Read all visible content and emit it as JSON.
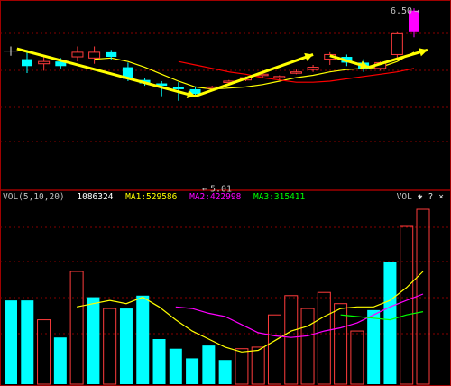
{
  "chart_data": [
    {
      "type": "candlestick",
      "annotations": {
        "high_label": "6.50",
        "low_label": "5.01"
      },
      "ylim": [
        4.95,
        6.54
      ],
      "candles": [
        {
          "o": 6.06,
          "h": 6.14,
          "l": 5.94,
          "c": 6.0,
          "dir": "down"
        },
        {
          "o": 6.02,
          "h": 6.08,
          "l": 5.96,
          "c": 6.04,
          "dir": "up"
        },
        {
          "o": 6.04,
          "h": 6.07,
          "l": 5.98,
          "c": 6.0,
          "dir": "down"
        },
        {
          "o": 6.08,
          "h": 6.17,
          "l": 6.04,
          "c": 6.12,
          "dir": "up"
        },
        {
          "o": 6.07,
          "h": 6.17,
          "l": 6.02,
          "c": 6.12,
          "dir": "up"
        },
        {
          "o": 6.12,
          "h": 6.14,
          "l": 6.05,
          "c": 6.08,
          "dir": "down"
        },
        {
          "o": 5.99,
          "h": 6.03,
          "l": 5.87,
          "c": 5.89,
          "dir": "down"
        },
        {
          "o": 5.88,
          "h": 5.9,
          "l": 5.83,
          "c": 5.85,
          "dir": "down"
        },
        {
          "o": 5.85,
          "h": 5.87,
          "l": 5.74,
          "c": 5.83,
          "dir": "down"
        },
        {
          "o": 5.82,
          "h": 5.86,
          "l": 5.7,
          "c": 5.8,
          "dir": "down"
        },
        {
          "o": 5.8,
          "h": 5.82,
          "l": 5.74,
          "c": 5.76,
          "dir": "down"
        },
        {
          "o": 5.82,
          "h": 5.83,
          "l": 5.81,
          "c": 5.82,
          "dir": "up"
        },
        {
          "o": 5.87,
          "h": 5.88,
          "l": 5.85,
          "c": 5.86,
          "dir": "up"
        },
        {
          "o": 5.88,
          "h": 5.91,
          "l": 5.87,
          "c": 5.9,
          "dir": "up"
        },
        {
          "o": 5.92,
          "h": 5.94,
          "l": 5.9,
          "c": 5.93,
          "dir": "up"
        },
        {
          "o": 5.9,
          "h": 5.92,
          "l": 5.88,
          "c": 5.91,
          "dir": "up"
        },
        {
          "o": 5.95,
          "h": 5.97,
          "l": 5.93,
          "c": 5.95,
          "dir": "up"
        },
        {
          "o": 5.97,
          "h": 6.01,
          "l": 5.95,
          "c": 5.99,
          "dir": "up"
        },
        {
          "o": 6.06,
          "h": 6.12,
          "l": 6.01,
          "c": 6.1,
          "dir": "up"
        },
        {
          "o": 6.08,
          "h": 6.1,
          "l": 6.0,
          "c": 6.03,
          "dir": "down"
        },
        {
          "o": 6.03,
          "h": 6.06,
          "l": 5.95,
          "c": 5.98,
          "dir": "down"
        },
        {
          "o": 5.98,
          "h": 6.04,
          "l": 5.96,
          "c": 6.03,
          "dir": "up"
        },
        {
          "o": 6.1,
          "h": 6.3,
          "l": 6.05,
          "c": 6.28,
          "dir": "up"
        },
        {
          "o": 6.3,
          "h": 6.5,
          "l": 6.25,
          "c": 6.48,
          "dir": "up"
        }
      ],
      "moving_averages": [
        {
          "color": "#ffff00",
          "values": [
            null,
            null,
            null,
            null,
            6.06,
            6.07,
            6.04,
            5.99,
            5.93,
            5.87,
            5.82,
            5.8,
            5.81,
            5.82,
            5.84,
            5.87,
            5.9,
            5.92,
            5.95,
            5.97,
            5.98,
            5.99,
            6.04,
            6.12
          ]
        },
        {
          "color": "#ff0000",
          "values": [
            null,
            null,
            null,
            null,
            null,
            null,
            null,
            null,
            null,
            6.04,
            6.01,
            5.98,
            5.95,
            5.93,
            5.9,
            5.88,
            5.86,
            5.86,
            5.87,
            5.89,
            5.91,
            5.93,
            5.95,
            5.98
          ]
        }
      ]
    },
    {
      "type": "bar",
      "indicator": "VOL(5,10,20)",
      "volume": "1086324",
      "ma_labels": [
        "MA1:529586",
        "MA2:422998",
        "MA3:315411"
      ],
      "ylim": [
        0,
        1120000
      ],
      "values": [
        520000,
        520000,
        400000,
        290000,
        700000,
        540000,
        470000,
        470000,
        550000,
        280000,
        220000,
        160000,
        240000,
        150000,
        220000,
        230000,
        430000,
        550000,
        470000,
        570000,
        500000,
        330000,
        460000,
        760000,
        980000,
        1086324
      ],
      "directions": [
        "down",
        "down",
        "up",
        "down",
        "up",
        "down",
        "up",
        "down",
        "down",
        "down",
        "down",
        "down",
        "down",
        "down",
        "up",
        "up",
        "up",
        "up",
        "up",
        "up",
        "up",
        "up",
        "down",
        "down",
        "up",
        "up"
      ],
      "series": [
        {
          "color": "#ffff00",
          "values": [
            null,
            null,
            null,
            null,
            480000,
            500000,
            520000,
            500000,
            540000,
            480000,
            400000,
            330000,
            280000,
            230000,
            200000,
            210000,
            270000,
            330000,
            360000,
            420000,
            470000,
            480000,
            480000,
            520000,
            600000,
            700000
          ]
        },
        {
          "color": "#ff00ff",
          "values": [
            null,
            null,
            null,
            null,
            null,
            null,
            null,
            null,
            null,
            null,
            480000,
            470000,
            440000,
            420000,
            370000,
            320000,
            300000,
            290000,
            300000,
            330000,
            350000,
            380000,
            430000,
            480000,
            520000,
            560000
          ]
        },
        {
          "color": "#00ff00",
          "values": [
            null,
            null,
            null,
            null,
            null,
            null,
            null,
            null,
            null,
            null,
            null,
            null,
            null,
            null,
            null,
            null,
            null,
            null,
            null,
            null,
            430000,
            420000,
            410000,
            400000,
            430000,
            450000
          ]
        }
      ]
    }
  ],
  "vol_panel": {
    "name": "VOL(5,10,20)",
    "volume": "1086324",
    "ma1": "MA1:529586",
    "ma2": "MA2:422998",
    "ma3": "MA3:315411",
    "mode_label": "VOL",
    "icons": [
      "gear-icon",
      "help-icon",
      "close-icon"
    ],
    "gear_glyph": "✱",
    "help_glyph": "?",
    "close_glyph": "×"
  },
  "colors": {
    "up": "#ff3c3c",
    "down": "#00ffff",
    "grid": "#880000",
    "frame": "#a00000",
    "label": "#c0c0c0",
    "trend_arrow": "#ffff00",
    "surge": "#ff00ff"
  }
}
